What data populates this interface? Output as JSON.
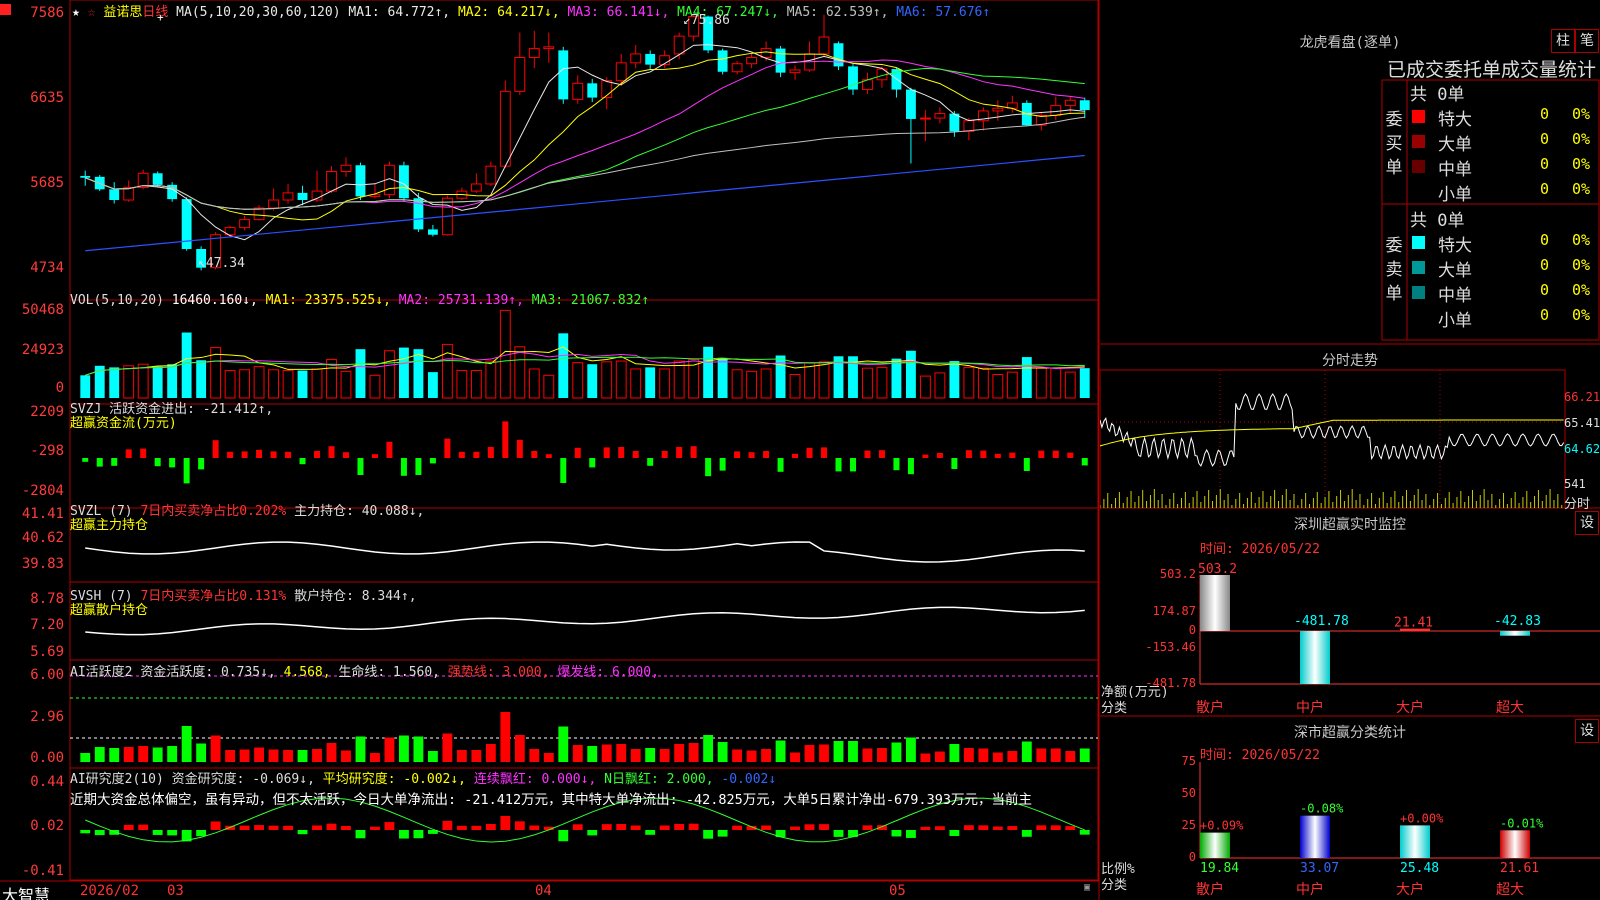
{
  "main_chart": {
    "stock_name": "益诺思",
    "period_label": "日线",
    "ma_params": "MA(5,10,20,30,60,120)",
    "ma_values": [
      {
        "label": "MA1: 64.772↑,",
        "color": "#e8e8e8"
      },
      {
        "label": "MA2: 64.217↓,",
        "color": "#ffff00"
      },
      {
        "label": "MA3: 66.141↓,",
        "color": "#ff33ff"
      },
      {
        "label": "MA4: 67.247↓,",
        "color": "#33ff33"
      },
      {
        "label": "MA5: 62.539↑,",
        "color": "#c0c0c0"
      },
      {
        "label": "MA6: 57.676↑",
        "color": "#3366ff"
      }
    ],
    "y_labels": [
      "75.86",
      "66.35",
      "56.85",
      "47.34"
    ],
    "y_labels_display": [
      "7586",
      "6635",
      "5685",
      "4734"
    ],
    "high_annotation": "75.86",
    "low_annotation": "47.34"
  },
  "volume": {
    "header": "VOL(5,10,20)",
    "value": "16460.160↓,",
    "ma1": "MA1: 23375.525↓,",
    "ma2": "MA2: 25731.139↑,",
    "ma3": "MA3: 21067.832↑",
    "y_labels": [
      "50468",
      "24923",
      "0"
    ]
  },
  "svzj": {
    "header": "SVZJ  活跃资金进出: -21.412↑,",
    "subtitle": "超赢资金流(万元)",
    "y_labels": [
      "2209",
      "-298",
      "-2804"
    ]
  },
  "svzl": {
    "header_a": "SVZL (7)",
    "header_b": "7日内买卖净占比0.202%",
    "header_c": "主力持仓: 40.088↓,",
    "subtitle": "超赢主力持仓",
    "y_labels": [
      "41.41",
      "40.62",
      "39.83"
    ]
  },
  "svsh": {
    "header_a": "SVSH (7)",
    "header_b": "7日内买卖净占比0.131%",
    "header_c": "散户持仓: 8.344↑,",
    "subtitle": "超赢散户持仓",
    "y_labels": [
      "8.78",
      "7.20",
      "5.69"
    ]
  },
  "ai_active": {
    "header_a": "AI活跃度2",
    "header_b": "资金活跃度: 0.735↓,",
    "header_c": "4.568,",
    "header_d": "生命线: 1.560,",
    "header_e": "强势线: 3.000,",
    "header_f": "爆发线: 6.000,",
    "y_labels": [
      "6.00",
      "2.96",
      "0.00"
    ]
  },
  "ai_research": {
    "header_a": "AI研究度2(10)",
    "header_b": "资金研究度: -0.069↓,",
    "header_c": "平均研究度: -0.002↓,",
    "header_d": "连续飘红: 0.000↓,",
    "header_e": "N日飘红: 2.000,",
    "header_f": "-0.002↓",
    "commentary": "近期大资金总体偏空，虽有异动，但不太活跃，今日大单净流出: -21.412万元，其中特大单净流出: -42.825万元，大单5日累计净出-679.393万元，当前主",
    "y_labels": [
      "0.44",
      "0.02",
      "-0.41"
    ]
  },
  "x_axis": {
    "labels": [
      "2026/02",
      "03",
      "04",
      "05"
    ],
    "brand": "大智慧"
  },
  "right_panel": {
    "dragon_title": "龙虎看盘(逐单)",
    "btn_column": "柱",
    "btn_pen": "笔",
    "order_stats_title": "已成交委托单成交量统计",
    "buy_label": "委买单",
    "sell_label": "委卖单",
    "buy_total": "共 0单",
    "sell_total": "共 0单",
    "buy_rows": [
      {
        "name": "特大",
        "count": "0",
        "pct": "0%",
        "color": "#ff0000"
      },
      {
        "name": "大单",
        "count": "0",
        "pct": "0%",
        "color": "#990000"
      },
      {
        "name": "中单",
        "count": "0",
        "pct": "0%",
        "color": "#660000"
      },
      {
        "name": "小单",
        "count": "0",
        "pct": "0%",
        "color": ""
      }
    ],
    "sell_rows": [
      {
        "name": "特大",
        "count": "0",
        "pct": "0%",
        "color": "#00ffff"
      },
      {
        "name": "大单",
        "count": "0",
        "pct": "0%",
        "color": "#009999"
      },
      {
        "name": "中单",
        "count": "0",
        "pct": "0%",
        "color": "#008080"
      },
      {
        "name": "小单",
        "count": "0",
        "pct": "0%",
        "color": ""
      }
    ],
    "intraday_title": "分时走势",
    "intraday_y": [
      "66.21",
      "65.41",
      "64.62"
    ],
    "intraday_vol": "541",
    "intraday_vol_unit": "分时",
    "sz_monitor_title": "深圳超赢实时监控",
    "sz_btn": "设",
    "sz_time": "时间: 2026/05/22",
    "sz_y": [
      "503.2",
      "174.87",
      "0",
      "-153.46",
      "-481.78"
    ],
    "sz_values": [
      {
        "cat": "散户",
        "value": 503.2,
        "label": "503.2"
      },
      {
        "cat": "中户",
        "value": -481.78,
        "label": "-481.78"
      },
      {
        "cat": "大户",
        "value": 21.41,
        "label": "21.41"
      },
      {
        "cat": "超大",
        "value": -42.83,
        "label": "-42.83"
      }
    ],
    "sz_ylabel": "净额(万元)",
    "sz_xlabel": "分类",
    "cls_title": "深市超赢分类统计",
    "cls_btn": "设",
    "cls_time": "时间: 2026/05/22",
    "cls_y": [
      "75",
      "50",
      "25",
      "0"
    ],
    "cls_values": [
      {
        "cat": "散户",
        "value": 19.84,
        "label": "19.84",
        "change": "+0.09%"
      },
      {
        "cat": "中户",
        "value": 33.07,
        "label": "33.07",
        "change": "-0.08%"
      },
      {
        "cat": "大户",
        "value": 25.48,
        "label": "25.48",
        "change": "+0.00%"
      },
      {
        "cat": "超大",
        "value": 21.61,
        "label": "21.61",
        "change": "-0.01%"
      }
    ],
    "cls_ylabel": "比例%",
    "cls_xlabel": "分类"
  },
  "chart_data": {
    "type": "candlestick",
    "x_labels": [
      "2026/02",
      "03",
      "04",
      "05"
    ],
    "ylim": [
      47.34,
      75.86
    ],
    "candles": [
      [
        57.9,
        57.7,
        58.5,
        56.8
      ],
      [
        57.8,
        56.4,
        58.0,
        56.2
      ],
      [
        56.4,
        55.2,
        57.2,
        54.8
      ],
      [
        55.2,
        56.6,
        57.4,
        55.0
      ],
      [
        56.6,
        58.2,
        58.6,
        56.4
      ],
      [
        58.2,
        56.9,
        58.4,
        56.6
      ],
      [
        56.9,
        55.3,
        57.2,
        55.0
      ],
      [
        55.3,
        49.7,
        55.5,
        49.5
      ],
      [
        49.7,
        47.6,
        50.0,
        47.3
      ],
      [
        47.6,
        51.3,
        51.6,
        47.4
      ],
      [
        51.3,
        52.1,
        52.3,
        51.0
      ],
      [
        52.1,
        53.0,
        53.4,
        51.8
      ],
      [
        53.0,
        54.3,
        54.6,
        52.9
      ],
      [
        54.3,
        55.2,
        56.5,
        54.0
      ],
      [
        55.2,
        56.0,
        57.0,
        54.8
      ],
      [
        56.0,
        55.2,
        56.8,
        54.6
      ],
      [
        55.2,
        56.2,
        58.5,
        55.0
      ],
      [
        56.2,
        58.4,
        59.0,
        56.0
      ],
      [
        58.4,
        59.1,
        60.0,
        57.8
      ],
      [
        59.1,
        55.6,
        59.4,
        55.2
      ],
      [
        55.6,
        55.8,
        57.0,
        55.4
      ],
      [
        55.8,
        59.1,
        59.5,
        55.4
      ],
      [
        59.1,
        55.4,
        59.5,
        55.0
      ],
      [
        55.4,
        51.9,
        56.0,
        51.6
      ],
      [
        51.9,
        51.3,
        52.4,
        51.1
      ],
      [
        51.3,
        55.4,
        55.7,
        51.2
      ],
      [
        55.4,
        56.2,
        56.6,
        55.2
      ],
      [
        56.2,
        57.0,
        58.2,
        56.0
      ],
      [
        57.0,
        59.0,
        59.5,
        56.8
      ],
      [
        59.0,
        67.4,
        68.6,
        58.8
      ],
      [
        67.4,
        71.2,
        74.0,
        67.0
      ],
      [
        71.2,
        72.2,
        74.2,
        70.0
      ],
      [
        72.2,
        72.4,
        74.0,
        70.6
      ],
      [
        72.0,
        66.5,
        72.4,
        66.0
      ],
      [
        66.5,
        68.3,
        69.2,
        66.0
      ],
      [
        68.3,
        66.7,
        68.8,
        66.2
      ],
      [
        66.7,
        68.6,
        69.0,
        65.4
      ],
      [
        68.6,
        70.6,
        71.6,
        68.0
      ],
      [
        70.6,
        71.6,
        72.6,
        70.0
      ],
      [
        71.6,
        70.4,
        72.0,
        69.8
      ],
      [
        70.4,
        71.4,
        72.0,
        70.0
      ],
      [
        71.6,
        73.6,
        74.0,
        71.0
      ],
      [
        73.6,
        75.8,
        75.9,
        73.0
      ],
      [
        75.8,
        72.0,
        75.9,
        71.7
      ],
      [
        72.0,
        69.6,
        72.2,
        69.3
      ],
      [
        69.6,
        70.5,
        70.8,
        69.3
      ],
      [
        70.5,
        71.2,
        71.6,
        70.0
      ],
      [
        71.2,
        72.2,
        73.0,
        70.8
      ],
      [
        72.2,
        69.5,
        72.5,
        69.0
      ],
      [
        69.5,
        69.8,
        70.3,
        68.7
      ],
      [
        69.8,
        71.6,
        73.0,
        69.6
      ],
      [
        71.6,
        73.5,
        76.0,
        71.2
      ],
      [
        72.8,
        70.2,
        73.0,
        69.8
      ],
      [
        70.2,
        67.6,
        70.5,
        67.0
      ],
      [
        67.6,
        68.7,
        69.5,
        67.1
      ],
      [
        68.7,
        69.9,
        70.2,
        67.8
      ],
      [
        69.9,
        67.6,
        70.0,
        66.7
      ],
      [
        67.6,
        64.3,
        67.8,
        59.3
      ],
      [
        64.3,
        64.4,
        65.3,
        61.8
      ],
      [
        64.4,
        64.9,
        65.6,
        63.8
      ],
      [
        64.9,
        62.9,
        65.2,
        62.3
      ],
      [
        62.9,
        64.1,
        64.4,
        61.9
      ],
      [
        64.1,
        65.2,
        65.6,
        63.0
      ],
      [
        65.2,
        65.5,
        66.4,
        64.1
      ],
      [
        65.5,
        66.1,
        66.9,
        65.0
      ],
      [
        66.1,
        63.6,
        66.4,
        63.5
      ],
      [
        63.6,
        64.7,
        65.1,
        63.0
      ],
      [
        64.7,
        65.8,
        66.8,
        64.2
      ],
      [
        65.8,
        66.4,
        66.8,
        65.0
      ],
      [
        66.4,
        65.3,
        66.7,
        64.4
      ]
    ],
    "volume_max": 50468
  }
}
